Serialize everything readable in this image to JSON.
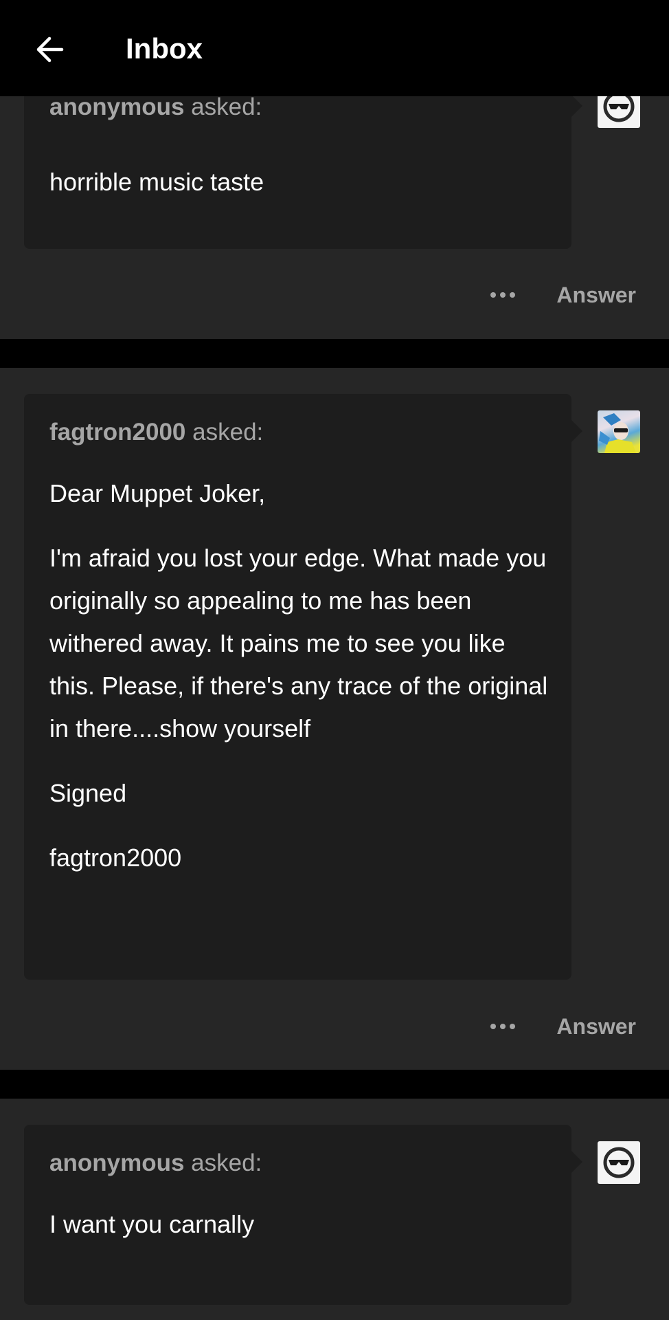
{
  "header": {
    "title": "Inbox",
    "back_icon": "arrow-left-icon"
  },
  "colors": {
    "background": "#000000",
    "card": "#262626",
    "bubble": "#1d1d1d",
    "muted_text": "#a6a6a6",
    "text": "#ffffff"
  },
  "asks": [
    {
      "asker": "anonymous",
      "asked_label": "asked:",
      "paragraphs": [
        "horrible music taste"
      ],
      "avatar": "anonymous-sunglasses-icon",
      "more_icon": "more-dots-icon",
      "answer_label": "Answer"
    },
    {
      "asker": "fagtron2000",
      "asked_label": "asked:",
      "paragraphs": [
        "Dear Muppet Joker,",
        "I'm afraid you lost your edge. What made you originally  so appealing to me has been withered away. It pains me to see you like this. Please, if there's any trace of the original in there....show yourself",
        "Signed",
        "fagtron2000"
      ],
      "avatar": "user-photo-avatar",
      "more_icon": "more-dots-icon",
      "answer_label": "Answer"
    },
    {
      "asker": "anonymous",
      "asked_label": "asked:",
      "paragraphs": [
        "I want you carnally"
      ],
      "avatar": "anonymous-sunglasses-icon"
    }
  ]
}
